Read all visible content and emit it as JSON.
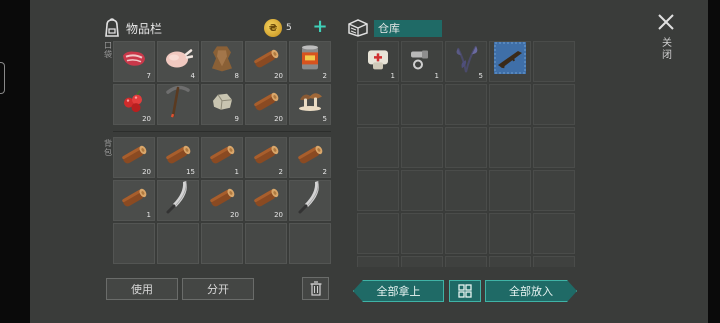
{
  "inventory": {
    "title": "物品栏",
    "pocket_label": "口袋",
    "bag_label": "背包",
    "coins": "5",
    "pocket_slots": [
      {
        "item": "raw-meat",
        "count": "7"
      },
      {
        "item": "raw-chicken",
        "count": "4"
      },
      {
        "item": "leather",
        "count": "8"
      },
      {
        "item": "log",
        "count": "20"
      },
      {
        "item": "canned-food",
        "count": "2"
      },
      {
        "item": "berries",
        "count": "20"
      },
      {
        "item": "pickaxe",
        "count": ""
      },
      {
        "item": "stone",
        "count": "9"
      },
      {
        "item": "log",
        "count": "20"
      },
      {
        "item": "mushroom",
        "count": "5"
      }
    ],
    "bag_slots": [
      {
        "item": "log",
        "count": "20"
      },
      {
        "item": "log",
        "count": "15"
      },
      {
        "item": "log",
        "count": "1"
      },
      {
        "item": "log",
        "count": "2"
      },
      {
        "item": "log",
        "count": "2"
      },
      {
        "item": "log",
        "count": "1"
      },
      {
        "item": "machete",
        "count": ""
      },
      {
        "item": "log",
        "count": "20"
      },
      {
        "item": "log",
        "count": "20"
      },
      {
        "item": "machete",
        "count": ""
      },
      {
        "item": "",
        "count": ""
      },
      {
        "item": "",
        "count": ""
      },
      {
        "item": "",
        "count": ""
      },
      {
        "item": "",
        "count": ""
      },
      {
        "item": "",
        "count": ""
      }
    ]
  },
  "warehouse": {
    "title": "仓库",
    "slots": [
      {
        "item": "bandage",
        "count": "1"
      },
      {
        "item": "bolts",
        "count": "1"
      },
      {
        "item": "herbs",
        "count": "5"
      },
      {
        "item": "rifle-blueprint",
        "count": ""
      },
      {
        "item": "",
        "count": ""
      }
    ]
  },
  "buttons": {
    "use": "使用",
    "split": "分开",
    "take_all": "全部拿上",
    "put_all": "全部放入",
    "close": "关闭"
  },
  "icons": {
    "bag": "backpack-icon",
    "coin": "coin-icon",
    "add": "plus-icon",
    "warehouse": "storage-box-icon",
    "trash": "trash-icon",
    "sort": "sort-grid-icon",
    "close": "close-x-icon"
  },
  "colors": {
    "accent": "#1f6a66",
    "accent_border": "#3fb3a6",
    "plus": "#3fd0b8",
    "background": "#3a3c3a"
  }
}
